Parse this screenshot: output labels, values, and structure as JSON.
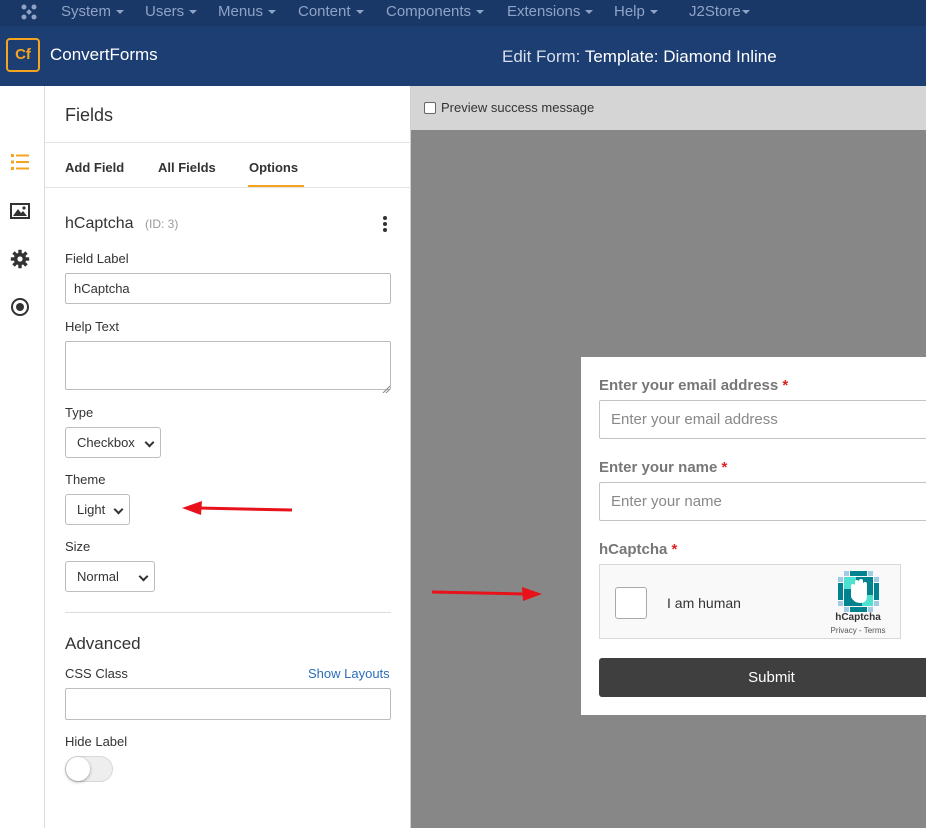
{
  "topbar": {
    "menus": [
      "System",
      "Users",
      "Menus",
      "Content",
      "Components",
      "Extensions",
      "Help",
      "J2Store"
    ]
  },
  "header": {
    "brand": "ConvertForms",
    "logo_text": "Cf",
    "edit_prefix": "Edit Form:",
    "edit_title": "Template: Diamond Inline"
  },
  "rail": {
    "icons": [
      "list-icon",
      "image-icon",
      "gear-icon",
      "target-icon"
    ]
  },
  "panel": {
    "title": "Fields",
    "tabs": [
      "Add Field",
      "All Fields",
      "Options"
    ],
    "active_tab": "Options",
    "field_name": "hCaptcha",
    "field_id": "(ID: 3)",
    "field_label_label": "Field Label",
    "field_label_value": "hCaptcha",
    "help_text_label": "Help Text",
    "help_text_value": "",
    "type_label": "Type",
    "type_value": "Checkbox",
    "theme_label": "Theme",
    "theme_value": "Light",
    "size_label": "Size",
    "size_value": "Normal",
    "advanced_title": "Advanced",
    "css_class_label": "CSS Class",
    "show_layouts": "Show Layouts",
    "css_class_value": "",
    "hide_label_label": "Hide Label",
    "hide_label_on": false
  },
  "preview": {
    "success_label": "Preview success message",
    "email_label": "Enter your email address",
    "email_placeholder": "Enter your email address",
    "name_label": "Enter your name",
    "name_placeholder": "Enter your name",
    "captcha_label": "hCaptcha",
    "required_mark": "*",
    "captcha_text": "I am human",
    "captcha_brand": "hCaptcha",
    "captcha_links": "Privacy - Terms",
    "submit": "Submit"
  },
  "colors": {
    "topbar": "#1a3867",
    "header": "#1c3e73",
    "accent": "#f4a41f",
    "annotation_arrow": "#e8121a",
    "submit": "#3f3f3f"
  }
}
